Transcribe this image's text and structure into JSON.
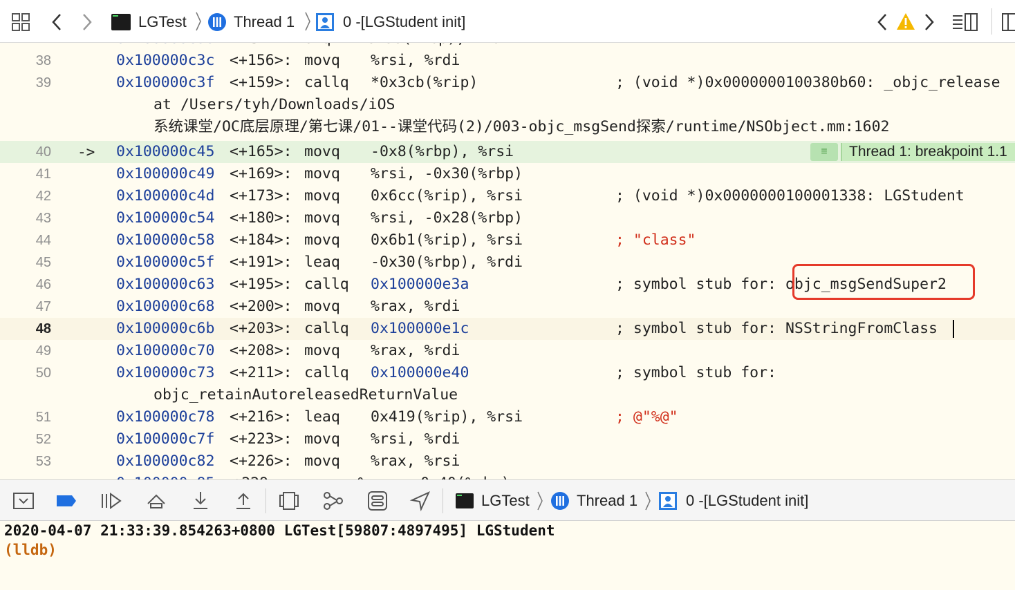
{
  "jumpbar": {
    "project": "LGTest",
    "thread": "Thread 1",
    "frame": "0 -[LGStudent init]"
  },
  "disassembly": {
    "rows": [
      {
        "line": "38",
        "addr": "0x100000c3c",
        "off": "<+156>:",
        "op": "movq",
        "args": "%rsi, %rdi",
        "comment": ""
      },
      {
        "line": "39",
        "addr": "0x100000c3f",
        "off": "<+159>:",
        "op": "callq",
        "args": "*0x3cb(%rip)",
        "comment": "; (void *)0x0000000100380b60: _objc_release"
      },
      {
        "line": "",
        "cont": "at /Users/tyh/Downloads/iOS"
      },
      {
        "line": "",
        "cont": "系统课堂/OC底层原理/第七课/01--课堂代码(2)/003-objc_msgSend探索/runtime/NSObject.mm:1602"
      },
      {
        "line": "40",
        "addr": "0x100000c45",
        "off": "<+165>:",
        "op": "movq",
        "args": "-0x8(%rbp), %rsi",
        "comment": "",
        "pc": true
      },
      {
        "line": "41",
        "addr": "0x100000c49",
        "off": "<+169>:",
        "op": "movq",
        "args": "%rsi, -0x30(%rbp)",
        "comment": ""
      },
      {
        "line": "42",
        "addr": "0x100000c4d",
        "off": "<+173>:",
        "op": "movq",
        "args": "0x6cc(%rip), %rsi",
        "comment": "; (void *)0x0000000100001338: LGStudent"
      },
      {
        "line": "43",
        "addr": "0x100000c54",
        "off": "<+180>:",
        "op": "movq",
        "args": "%rsi, -0x28(%rbp)",
        "comment": ""
      },
      {
        "line": "44",
        "addr": "0x100000c58",
        "off": "<+184>:",
        "op": "movq",
        "args": "0x6b1(%rip), %rsi",
        "comment": "; \"class\""
      },
      {
        "line": "45",
        "addr": "0x100000c5f",
        "off": "<+191>:",
        "op": "leaq",
        "args": "-0x30(%rbp), %rdi",
        "comment": ""
      },
      {
        "line": "46",
        "addr": "0x100000c63",
        "off": "<+195>:",
        "op": "callq",
        "args": "0x100000e3a",
        "comment": "; symbol stub for: objc_msgSendSuper2"
      },
      {
        "line": "47",
        "addr": "0x100000c68",
        "off": "<+200>:",
        "op": "movq",
        "args": "%rax, %rdi",
        "comment": ""
      },
      {
        "line": "48",
        "addr": "0x100000c6b",
        "off": "<+203>:",
        "op": "callq",
        "args": "0x100000e1c",
        "comment": "; symbol stub for: NSStringFromClass",
        "current": true
      },
      {
        "line": "49",
        "addr": "0x100000c70",
        "off": "<+208>:",
        "op": "movq",
        "args": "%rax, %rdi",
        "comment": ""
      },
      {
        "line": "50",
        "addr": "0x100000c73",
        "off": "<+211>:",
        "op": "callq",
        "args": "0x100000e40",
        "comment": "; symbol stub for:"
      },
      {
        "line": "",
        "cont": "objc_retainAutoreleasedReturnValue"
      },
      {
        "line": "51",
        "addr": "0x100000c78",
        "off": "<+216>:",
        "op": "leaq",
        "args": "0x419(%rip), %rsi",
        "comment": "; @\"%@\""
      },
      {
        "line": "52",
        "addr": "0x100000c7f",
        "off": "<+223>:",
        "op": "movq",
        "args": "%rsi, %rdi",
        "comment": ""
      },
      {
        "line": "53",
        "addr": "0x100000c82",
        "off": "<+226>:",
        "op": "movq",
        "args": "%rax, %rsi",
        "comment": ""
      }
    ],
    "pc_arrow": "->",
    "breakpoint_label": "Thread 1: breakpoint 1.1"
  },
  "debugbar": {
    "project": "LGTest",
    "thread": "Thread 1",
    "frame": "0 -[LGStudent init]"
  },
  "console": {
    "output": "2020-04-07 21:33:39.854263+0800 LGTest[59807:4897495] LGStudent",
    "prompt": "(lldb)"
  },
  "colors": {
    "address": "#1c3f9a",
    "string": "#d12f1b",
    "pc_line": "#e6f3de",
    "highlight_box": "#e53a2a",
    "prompt": "#c5660f"
  }
}
